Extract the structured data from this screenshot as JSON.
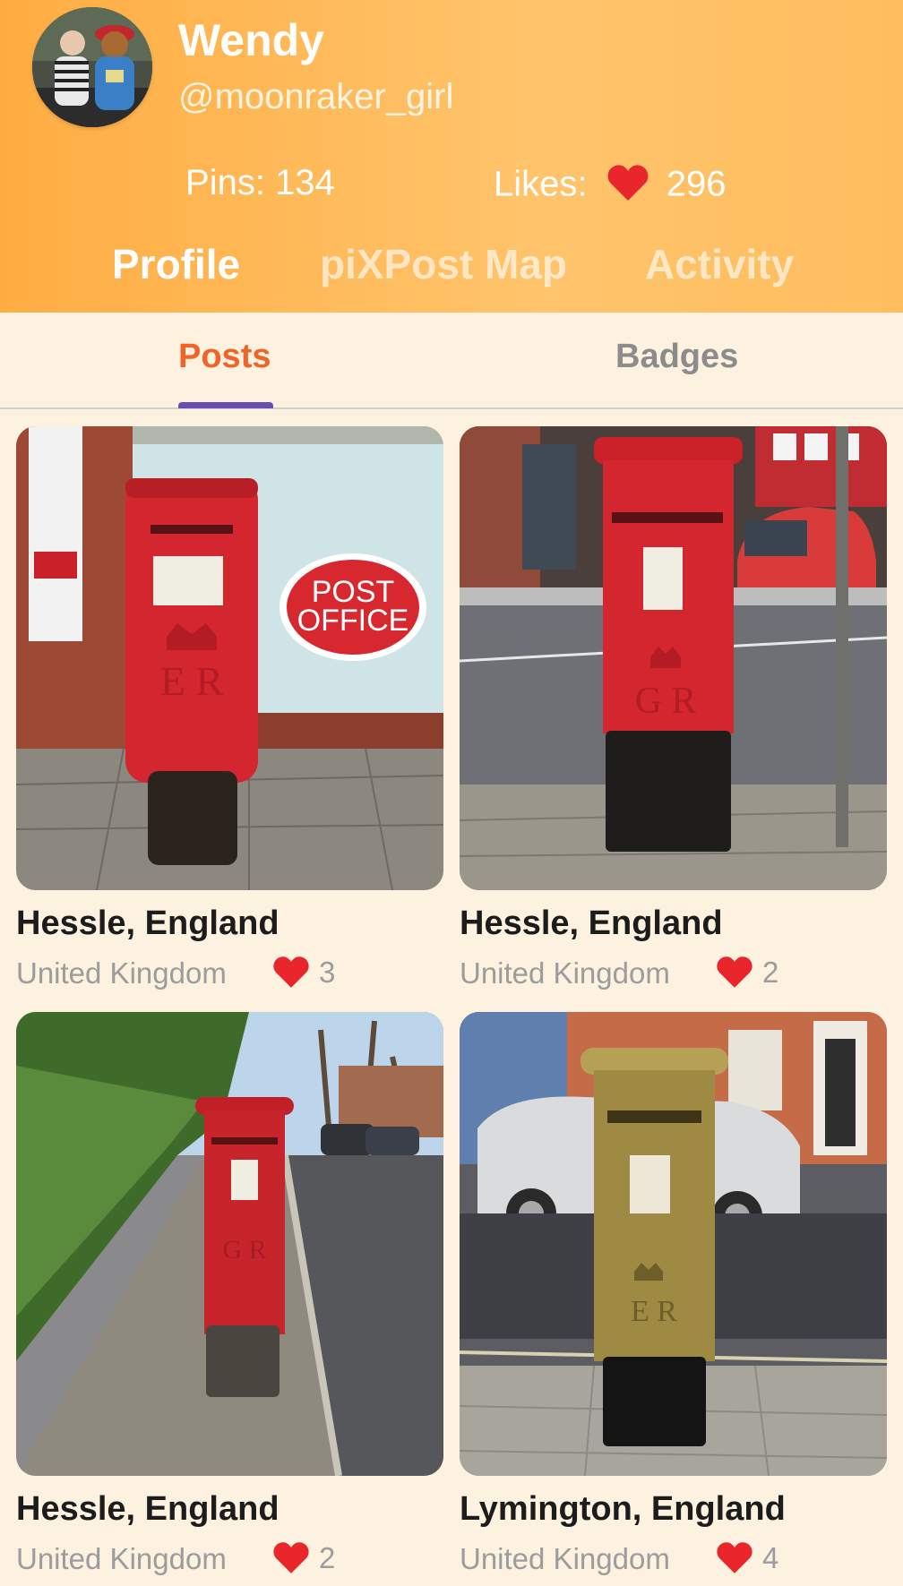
{
  "profile": {
    "name": "Wendy",
    "handle": "@moonraker_girl",
    "pins_text": "Pins: 134",
    "likes_label": "Likes:",
    "likes_count": "296"
  },
  "nav": {
    "tabs": [
      {
        "label": "Profile",
        "active": true
      },
      {
        "label": "piXPost Map",
        "active": false
      },
      {
        "label": "Activity",
        "active": false
      }
    ]
  },
  "subtabs": [
    {
      "label": "Posts",
      "active": true
    },
    {
      "label": "Badges",
      "active": false
    }
  ],
  "posts": [
    {
      "title": "Hessle, England",
      "country": "United Kingdom",
      "likes": "3"
    },
    {
      "title": "Hessle, England",
      "country": "United Kingdom",
      "likes": "2"
    },
    {
      "title": "Hessle, England",
      "country": "United Kingdom",
      "likes": "2"
    },
    {
      "title": "Lymington, England",
      "country": "United Kingdom",
      "likes": "4"
    }
  ],
  "photo_sign_text": [
    "POST",
    "OFFICE"
  ],
  "icons": {
    "like": "heart-icon"
  },
  "colors": {
    "header_start": "#ffad42",
    "header_end": "#ffc46c",
    "active_subtab": "#f0642a",
    "inactive_subtab": "#8c8c8c",
    "tab_indicator": "#6a4fb0",
    "heart": "#e8262b",
    "background": "#fdf1e0"
  }
}
